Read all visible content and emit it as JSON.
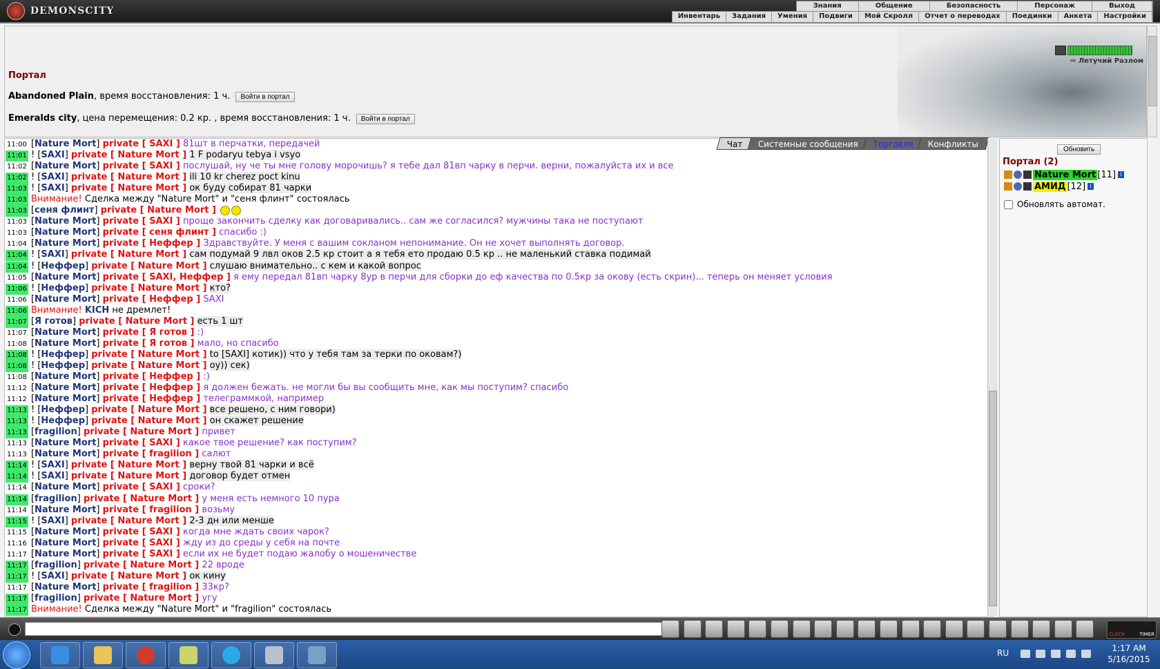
{
  "header": {
    "logo_text": "DEMONSCITY",
    "nav_top": [
      "Знания",
      "Общение",
      "Безопасность",
      "Персонаж",
      "Выход"
    ],
    "nav_bottom": [
      "Инвентарь",
      "Задания",
      "Умения",
      "Подвиги",
      "Мой Скролл",
      "Отчет о переводах",
      "Поединки",
      "Анкета",
      "Настройки"
    ]
  },
  "portal": {
    "title": "Портал",
    "rows": [
      {
        "name": "Abandoned Plain",
        "info": ", время восстановления: 1 ч.",
        "button": "Войти в портал"
      },
      {
        "name": "Emeralds city",
        "info": ", цена перемещения: 0.2 кр. , время восстановления: 1 ч.",
        "button": "Войти в портал"
      }
    ],
    "location_link": "Летучий Разлом",
    "hp_level": 1.0
  },
  "chat_tabs": [
    {
      "label": "Чат",
      "active": true
    },
    {
      "label": "Системные сообщения",
      "active": false
    },
    {
      "label": "Торговля",
      "active": false
    },
    {
      "label": "Конфликты",
      "active": false
    }
  ],
  "chat": [
    {
      "ts": "11:00",
      "hl": false,
      "ex": false,
      "nick": "Nature Mort",
      "priv": "private [ SAXI ]",
      "text": "81шт в перчатки, передачей",
      "own": true
    },
    {
      "ts": "11:01",
      "hl": true,
      "ex": true,
      "nick": "SAXI",
      "priv": "private [ Nature Mort ]",
      "text": "1 F podaryu tebya i vsyo",
      "own": false
    },
    {
      "ts": "11:02",
      "hl": false,
      "ex": false,
      "nick": "Nature Mort",
      "priv": "private [ SAXI ]",
      "text": "послушай, ну че ты мне голову морочишь? я тебе дал 81вп чарку в перчи. верни, пожалуйста их и все",
      "own": true
    },
    {
      "ts": "11:02",
      "hl": true,
      "ex": true,
      "nick": "SAXI",
      "priv": "private [ Nature Mort ]",
      "text": "ili 10 kr cherez poct kinu",
      "own": false
    },
    {
      "ts": "11:03",
      "hl": true,
      "ex": true,
      "nick": "SAXI",
      "priv": "private [ Nature Mort ]",
      "text": "ок буду собират 81 чарки",
      "own": false
    },
    {
      "ts": "11:03",
      "hl": true,
      "sys": true,
      "warn": "Внимание!",
      "text": "Сделка между \"Nature Mort\" и \"сеня флинт\" состоялась"
    },
    {
      "ts": "11:03",
      "hl": true,
      "ex": false,
      "nick": "сеня флинт",
      "priv": "private [ Nature Mort ]",
      "text": "",
      "own": false,
      "smileys": 2
    },
    {
      "ts": "11:03",
      "hl": false,
      "ex": false,
      "nick": "Nature Mort",
      "priv": "private [ SAXI ]",
      "text": "проще закончить сделку как договаривались.. сам же согласился? мужчины така не поступают",
      "own": true
    },
    {
      "ts": "11:03",
      "hl": false,
      "ex": false,
      "nick": "Nature Mort",
      "priv": "private [ сеня флинт ]",
      "text": "спасибо :)",
      "own": true
    },
    {
      "ts": "11:04",
      "hl": false,
      "ex": false,
      "nick": "Nature Mort",
      "priv": "private [ Неффер ]",
      "text": "Здравствуйте. У меня с вашим сокланом непонимание. Он не хочет выполнять договор.",
      "own": true
    },
    {
      "ts": "11:04",
      "hl": true,
      "ex": true,
      "nick": "SAXI",
      "priv": "private [ Nature Mort ]",
      "text": "сам подумай 9 лвл оков 2.5 кр стоит а я тебя ето продаю 0.5 кр .. не маленький ставка подимай",
      "own": false
    },
    {
      "ts": "11:04",
      "hl": true,
      "ex": true,
      "nick": "Неффер",
      "priv": "private [ Nature Mort ]",
      "text": "слушаю внимательно.. с кем и какой вопрос",
      "own": false
    },
    {
      "ts": "11:05",
      "hl": false,
      "ex": false,
      "nick": "Nature Mort",
      "priv": "private [ SAXI, Неффер ]",
      "text": "я ему передал 81вп чарку 8ур в перчи для сборки до еф качества по 0.5кр за окову (есть скрин)... теперь он меняет условия",
      "own": true
    },
    {
      "ts": "11:06",
      "hl": true,
      "ex": true,
      "nick": "Неффер",
      "priv": "private [ Nature Mort ]",
      "text": "кто?",
      "own": false
    },
    {
      "ts": "11:06",
      "hl": false,
      "ex": false,
      "nick": "Nature Mort",
      "priv": "private [ Неффер ]",
      "text": "SAXI",
      "own": true
    },
    {
      "ts": "11:06",
      "hl": true,
      "sys": true,
      "warn": "Внимание!",
      "text_bold": "KICH",
      "text": " не дремлет!"
    },
    {
      "ts": "11:07",
      "hl": true,
      "ex": false,
      "nick": "Я готов",
      "priv": "private [ Nature Mort ]",
      "text": "есть 1 шт",
      "own": false
    },
    {
      "ts": "11:07",
      "hl": false,
      "ex": false,
      "nick": "Nature Mort",
      "priv": "private [ Я готов ]",
      "text": ":)",
      "own": true
    },
    {
      "ts": "11:08",
      "hl": false,
      "ex": false,
      "nick": "Nature Mort",
      "priv": "private [ Я готов ]",
      "text": "мало, но спасибо",
      "own": true
    },
    {
      "ts": "11:08",
      "hl": true,
      "ex": true,
      "nick": "Неффер",
      "priv": "private [ Nature Mort ]",
      "text": "to [SAXI] котик)) что у тебя там за терки по оковам?)",
      "own": false
    },
    {
      "ts": "11:08",
      "hl": true,
      "ex": true,
      "nick": "Неффер",
      "priv": "private [ Nature Mort ]",
      "text": "оу)) сек)",
      "own": false
    },
    {
      "ts": "11:08",
      "hl": false,
      "ex": false,
      "nick": "Nature Mort",
      "priv": "private [ Неффер ]",
      "text": ":)",
      "own": true
    },
    {
      "ts": "11:12",
      "hl": false,
      "ex": false,
      "nick": "Nature Mort",
      "priv": "private [ Неффер ]",
      "text": "я должен бежать. не могли бы вы сообщить мне, как мы поступим? спасибо",
      "own": true
    },
    {
      "ts": "11:12",
      "hl": false,
      "ex": false,
      "nick": "Nature Mort",
      "priv": "private [ Неффер ]",
      "text": "телеграммкой, например",
      "own": true
    },
    {
      "ts": "11:13",
      "hl": true,
      "ex": true,
      "nick": "Неффер",
      "priv": "private [ Nature Mort ]",
      "text": "все решено, с ним говори)",
      "own": false
    },
    {
      "ts": "11:13",
      "hl": true,
      "ex": true,
      "nick": "Неффер",
      "priv": "private [ Nature Mort ]",
      "text": "он скажет решение",
      "own": false
    },
    {
      "ts": "11:13",
      "hl": true,
      "ex": false,
      "nick": "fragilion",
      "priv": "private [ Nature Mort ]",
      "text": "привет",
      "own": true
    },
    {
      "ts": "11:13",
      "hl": false,
      "ex": false,
      "nick": "Nature Mort",
      "priv": "private [ SAXI ]",
      "text": "какое твое решение? как поступим?",
      "own": true
    },
    {
      "ts": "11:13",
      "hl": false,
      "ex": false,
      "nick": "Nature Mort",
      "priv": "private [ fragilion ]",
      "text": "салют",
      "own": true
    },
    {
      "ts": "11:14",
      "hl": true,
      "ex": true,
      "nick": "SAXI",
      "priv": "private [ Nature Mort ]",
      "text": "верну твой 81 чарки и всё",
      "own": false
    },
    {
      "ts": "11:14",
      "hl": true,
      "ex": true,
      "nick": "SAXI",
      "priv": "private [ Nature Mort ]",
      "text": "договор будет отмен",
      "own": false
    },
    {
      "ts": "11:14",
      "hl": false,
      "ex": false,
      "nick": "Nature Mort",
      "priv": "private [ SAXI ]",
      "text": "сроки?",
      "own": true
    },
    {
      "ts": "11:14",
      "hl": true,
      "ex": false,
      "nick": "fragilion",
      "priv": "private [ Nature Mort ]",
      "text": "у меня есть немного 10 пура",
      "own": true
    },
    {
      "ts": "11:14",
      "hl": false,
      "ex": false,
      "nick": "Nature Mort",
      "priv": "private [ fragilion ]",
      "text": "возьму",
      "own": true
    },
    {
      "ts": "11:15",
      "hl": true,
      "ex": true,
      "nick": "SAXI",
      "priv": "private [ Nature Mort ]",
      "text": "2-3 дн или менше",
      "own": false
    },
    {
      "ts": "11:15",
      "hl": false,
      "ex": false,
      "nick": "Nature Mort",
      "priv": "private [ SAXI ]",
      "text": "когда мне ждать своих чарок?",
      "own": true
    },
    {
      "ts": "11:16",
      "hl": false,
      "ex": false,
      "nick": "Nature Mort",
      "priv": "private [ SAXI ]",
      "text": "жду из до среды у себя на почте",
      "own": true
    },
    {
      "ts": "11:17",
      "hl": false,
      "ex": false,
      "nick": "Nature Mort",
      "priv": "private [ SAXI ]",
      "text": "если их не будет подаю жалобу о мошеничестве",
      "own": true
    },
    {
      "ts": "11:17",
      "hl": true,
      "ex": false,
      "nick": "fragilion",
      "priv": "private [ Nature Mort ]",
      "text": "22 вроде",
      "own": true
    },
    {
      "ts": "11:17",
      "hl": true,
      "ex": true,
      "nick": "SAXI",
      "priv": "private [ Nature Mort ]",
      "text": "ок кину",
      "own": false
    },
    {
      "ts": "11:17",
      "hl": false,
      "ex": false,
      "nick": "Nature Mort",
      "priv": "private [ fragilion ]",
      "text": "33кр?",
      "own": true
    },
    {
      "ts": "11:17",
      "hl": true,
      "ex": false,
      "nick": "fragilion",
      "priv": "private [ Nature Mort ]",
      "text": "угу",
      "own": true
    },
    {
      "ts": "11:17",
      "hl": true,
      "sys": true,
      "warn": "Внимание!",
      "text": "Сделка между \"Nature Mort\" и \"fragilion\" состоялась"
    }
  ],
  "online": {
    "refresh_button": "Обновить",
    "title": "Портал (2)",
    "users": [
      {
        "name": "Nature Mort",
        "level": "[11]",
        "highlight": "#28d628"
      },
      {
        "name": "АМИД",
        "level": "[12]",
        "highlight": "#f0f000"
      }
    ],
    "auto_refresh_label": "Обновлять автомат."
  },
  "toolbar": {
    "input_value": "",
    "clock_label": "CLOCK",
    "timer_label": "TIMER",
    "tools": [
      "enter-icon",
      "eraser-icon",
      "filter-icon",
      "save-icon",
      "fight-icon",
      "transfer-icon",
      "sound-icon",
      "smile-icon",
      "clan-icon",
      "bag-icon",
      "hammer-icon",
      "potion-icon",
      "gift-icon",
      "magic-icon",
      "rune-icon",
      "globe-icon",
      "house-icon",
      "trap-icon",
      "flag-icon",
      "exit-icon"
    ]
  },
  "taskbar": {
    "lang": "RU",
    "time": "1:17 AM",
    "date": "5/16/2015",
    "apps": [
      "ie-icon",
      "explorer-icon",
      "chrome-icon",
      "folder-icon",
      "skype-icon",
      "calculator-icon",
      "window-icon"
    ]
  }
}
